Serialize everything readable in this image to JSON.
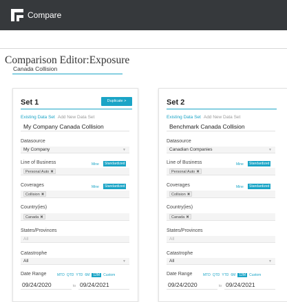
{
  "app": {
    "title": "Compare"
  },
  "editor": {
    "title": "Comparison Editor:Exposure",
    "analysis_name": "Canada Collision"
  },
  "sets": [
    {
      "title": "Set 1",
      "duplicate_label": "Duplicate >",
      "tabs": {
        "existing": "Existing Data Set",
        "add_new": "Add New Data Set"
      },
      "data_set_name": "My Company Canada Collision",
      "datasource": {
        "label": "Datasource",
        "value": "My Company"
      },
      "line_of_business": {
        "label": "Line of Business",
        "mine": "Mine",
        "standardized": "Standardized",
        "chips": [
          "Personal Auto"
        ]
      },
      "coverages": {
        "label": "Coverages",
        "mine": "Mine",
        "standardized": "Standardized",
        "chips": [
          "Collision"
        ]
      },
      "countries": {
        "label": "Country(ies)",
        "chips": [
          "Canada"
        ]
      },
      "states": {
        "label": "States/Provinces",
        "placeholder": "All"
      },
      "catastrophe": {
        "label": "Catastrophe",
        "value": "All"
      },
      "date_range": {
        "label": "Date Range",
        "presets": [
          "MTD",
          "QTD",
          "YTD",
          "6M",
          "12M",
          "Custom"
        ],
        "selected": "12M",
        "from": "09/24/2020",
        "to_label": "to",
        "to": "09/24/2021"
      }
    },
    {
      "title": "Set 2",
      "tabs": {
        "existing": "Existing Data Set",
        "add_new": "Add New Data Set"
      },
      "data_set_name": "Benchmark Canada Collision",
      "datasource": {
        "label": "Datasource",
        "value": "Canadian Companies"
      },
      "line_of_business": {
        "label": "Line of Business",
        "mine": "Mine",
        "standardized": "Standardized",
        "chips": [
          "Personal Auto"
        ]
      },
      "coverages": {
        "label": "Coverages",
        "mine": "Mine",
        "standardized": "Standardized",
        "chips": [
          "Collision"
        ]
      },
      "countries": {
        "label": "Country(ies)",
        "chips": [
          "Canada"
        ]
      },
      "states": {
        "label": "States/Provinces",
        "placeholder": "All"
      },
      "catastrophe": {
        "label": "Catastrophe",
        "value": "All"
      },
      "date_range": {
        "label": "Date Range",
        "presets": [
          "MTD",
          "QTD",
          "YTD",
          "6M",
          "12M",
          "Custom"
        ],
        "selected": "12M",
        "from": "09/24/2020",
        "to_label": "to",
        "to": "09/24/2021"
      }
    }
  ],
  "icons": {
    "logo": "compare-logo-icon",
    "remove": "close-icon",
    "dropdown": "chevron-down-icon"
  },
  "colors": {
    "accent": "#1aa4c6",
    "header": "#36393c"
  }
}
